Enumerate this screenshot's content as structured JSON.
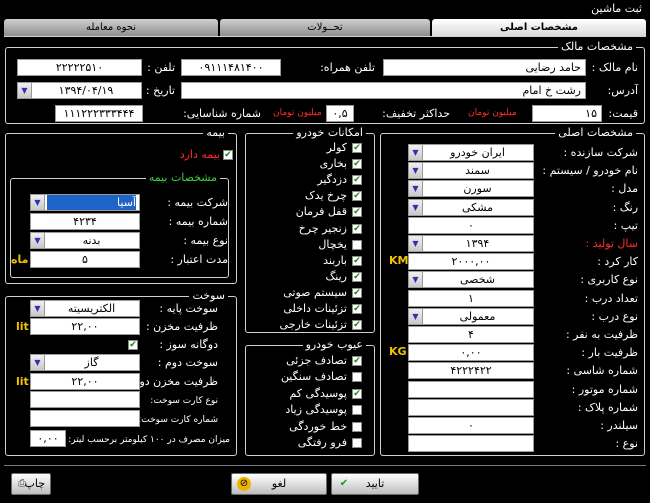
{
  "window": {
    "title": "ثبت ماشین"
  },
  "tabs": [
    {
      "label": "مشخصات اصلی",
      "active": true
    },
    {
      "label": "تحــولات",
      "active": false
    },
    {
      "label": "نحوه معامله",
      "active": false
    }
  ],
  "owner": {
    "section_title": "مشخصات مالک",
    "name_label": "نام مالک :",
    "name_value": "حامد رضایی",
    "mobile_label": "تلفن همراه:",
    "mobile_value": "۰۹۱۱۱۴۸۱۴۰۰",
    "phone_label": "تلفن :",
    "phone_value": "۲۲۲۲۲۵۱۰",
    "address_label": "آدرس:",
    "address_value": "رشت خ امام",
    "date_label": "تاریخ :",
    "date_value": "۱۳۹۴/۰۴/۱۹",
    "price_label": "قیمت:",
    "price_value": "۱۵",
    "price_unit": "میلیون تومان",
    "max_discount_label": "حداکثر تخفیف:",
    "max_discount_value": "۰,۵",
    "discount_unit": "میلیون تومان",
    "id_label": "شماره شناسایی:",
    "id_value": "۱۱۱۲۲۲۳۳۳۴۴۴"
  },
  "main_specs": {
    "section_title": "مشخصات اصلی",
    "fields": [
      {
        "label": "شرکت سازنده :",
        "value": "ایران خودرو",
        "type": "select",
        "name": "manufacturer"
      },
      {
        "label": "نام خودرو / سیستم :",
        "value": "سمند",
        "type": "select",
        "name": "car-name"
      },
      {
        "label": "مدل :",
        "value": "سورن",
        "type": "select",
        "name": "model"
      },
      {
        "label": "رنگ :",
        "value": "مشکی",
        "type": "select",
        "name": "color"
      },
      {
        "label": "تیپ :",
        "value": "۰",
        "type": "input",
        "name": "type"
      },
      {
        "label": "سال تولید :",
        "value": "۱۳۹۴",
        "type": "select",
        "name": "year",
        "red": true
      },
      {
        "label": "کار کرد :",
        "value": "۲۰۰۰,۰۰",
        "type": "input",
        "name": "mileage",
        "unit": "KM"
      },
      {
        "label": "نوع کاربری :",
        "value": "شخصی",
        "type": "select",
        "name": "usage"
      },
      {
        "label": "تعداد درب :",
        "value": "۱",
        "type": "input",
        "name": "door-count"
      },
      {
        "label": "نوع درب :",
        "value": "معمولی",
        "type": "select",
        "name": "door-type"
      },
      {
        "label": "ظرفیت به نفر :",
        "value": "۴",
        "type": "input",
        "name": "capacity"
      },
      {
        "label": "ظرفیت بار :",
        "value": "۰,۰۰",
        "type": "input",
        "name": "load",
        "unit": "KG"
      },
      {
        "label": "شماره شاسی :",
        "value": "۴۲۲۲۴۲۲",
        "type": "input",
        "name": "chassis"
      },
      {
        "label": "شماره موتور :",
        "value": "",
        "type": "input",
        "name": "engine"
      },
      {
        "label": "شماره پلاک :",
        "value": "",
        "type": "input",
        "name": "plate"
      },
      {
        "label": "سیلندر :",
        "value": "۰",
        "type": "input",
        "name": "cylinder"
      },
      {
        "label": "نوع :",
        "value": "",
        "type": "input",
        "name": "kind"
      }
    ]
  },
  "features": {
    "section_title": "امکانات خودرو",
    "items": [
      {
        "label": "کولر",
        "checked": true
      },
      {
        "label": "بخاری",
        "checked": true
      },
      {
        "label": "دزدگیر",
        "checked": true
      },
      {
        "label": "چرخ یدک",
        "checked": true
      },
      {
        "label": "قفل فرمان",
        "checked": true
      },
      {
        "label": "زنجیر چرخ",
        "checked": true
      },
      {
        "label": "یخچال",
        "checked": false
      },
      {
        "label": "باربند",
        "checked": true
      },
      {
        "label": "رینگ",
        "checked": true
      },
      {
        "label": "سیستم صوتی",
        "checked": true
      },
      {
        "label": "تزئینات داخلی",
        "checked": true
      },
      {
        "label": "تزئینات خارجی",
        "checked": true
      }
    ]
  },
  "defects": {
    "section_title": "عیوب خودرو",
    "items": [
      {
        "label": "تصادف جزئی",
        "checked": true
      },
      {
        "label": "تصادف سنگین",
        "checked": false
      },
      {
        "label": "پوسیدگی کم",
        "checked": true
      },
      {
        "label": "پوسیدگی زیاد",
        "checked": false
      },
      {
        "label": "خط خوردگی",
        "checked": false
      },
      {
        "label": "فرو رفتگی",
        "checked": false
      }
    ]
  },
  "insurance": {
    "section_title": "بیمه",
    "has_insurance_label": "بیمه دارد",
    "has_insurance_checked": true,
    "specs_title": "مشخصات بیمه",
    "company_label": "شرکت بیمه :",
    "company_value": "آسیا",
    "number_label": "شماره بیمه :",
    "number_value": "۴۲۳۴",
    "kind_label": "نوع بیمه :",
    "kind_value": "بدنه",
    "validity_label": "مدت اعتبار :",
    "validity_value": "۵",
    "validity_unit": "ماه"
  },
  "fuel": {
    "section_title": "سوخت",
    "base_label": "سوخت پایه :",
    "base_value": "الکتریسیته",
    "tank_label": "ظرفیت مخزن :",
    "tank_value": "۲۲,۰۰",
    "tank_unit": "lit",
    "dual_label": "دوگانه سوز :",
    "dual_checked": true,
    "second_label": "سوخت دوم :",
    "second_value": "گاز",
    "tank2_label": "ظرفیت مخزن دوم:",
    "tank2_value": "۲۲,۰۰",
    "tank2_unit": "lit",
    "card_type_label": "نوع کارت سوخت:",
    "card_type_value": "",
    "card_number_label": "شماره کارت سوخت:",
    "card_number_value": "",
    "consumption_label": "میزان مصرف در ۱۰۰ کیلومتر برحسب لیتر:",
    "consumption_value": "۰,۰۰"
  },
  "footer": {
    "print_label": "چاپ",
    "cancel_label": "لغو",
    "confirm_label": "تایید"
  }
}
